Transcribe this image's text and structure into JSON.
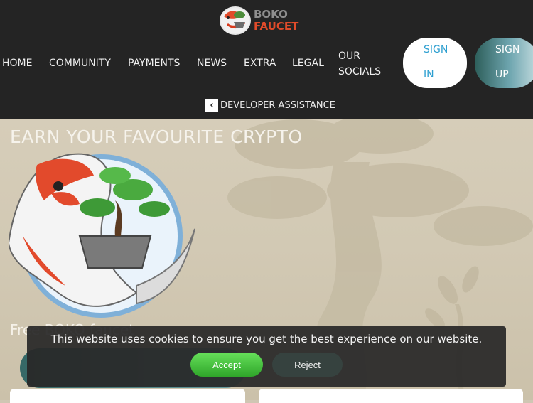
{
  "header": {
    "logo_line1": "BOKO",
    "logo_line2": "FAUCET",
    "nav": {
      "home": "HOME",
      "community": "COMMUNITY",
      "payments": "PAYMENTS",
      "news": "NEWS",
      "extra": "EXTRA",
      "legal": "LEGAL",
      "socials_line1": "OUR",
      "socials_line2": "SOCIALS"
    },
    "signin_line1": "SIGN",
    "signin_line2": "IN",
    "signup_line1": "SIGN",
    "signup_line2": "UP",
    "developer_assistance": "DEVELOPER ASSISTANCE"
  },
  "hero": {
    "headline": "EARN YOUR FAVOURITE CRYPTO",
    "subtext": "Free BOKO faucet"
  },
  "cookie": {
    "message": "This website uses cookies to ensure you get the best experience on our website.",
    "accept": "Accept",
    "reject": "Reject"
  },
  "colors": {
    "header_bg": "#242424",
    "brand_orange": "#e04b2a",
    "signin_text": "#2d9fd0",
    "accept_green": "#3cbf35",
    "reject_dark": "#36423f",
    "teal": "#356866"
  },
  "icons": {
    "logo": "koi-bonsai-logo",
    "chevron": "chevron-left-icon",
    "mascot": "koi-bonsai-illustration"
  }
}
